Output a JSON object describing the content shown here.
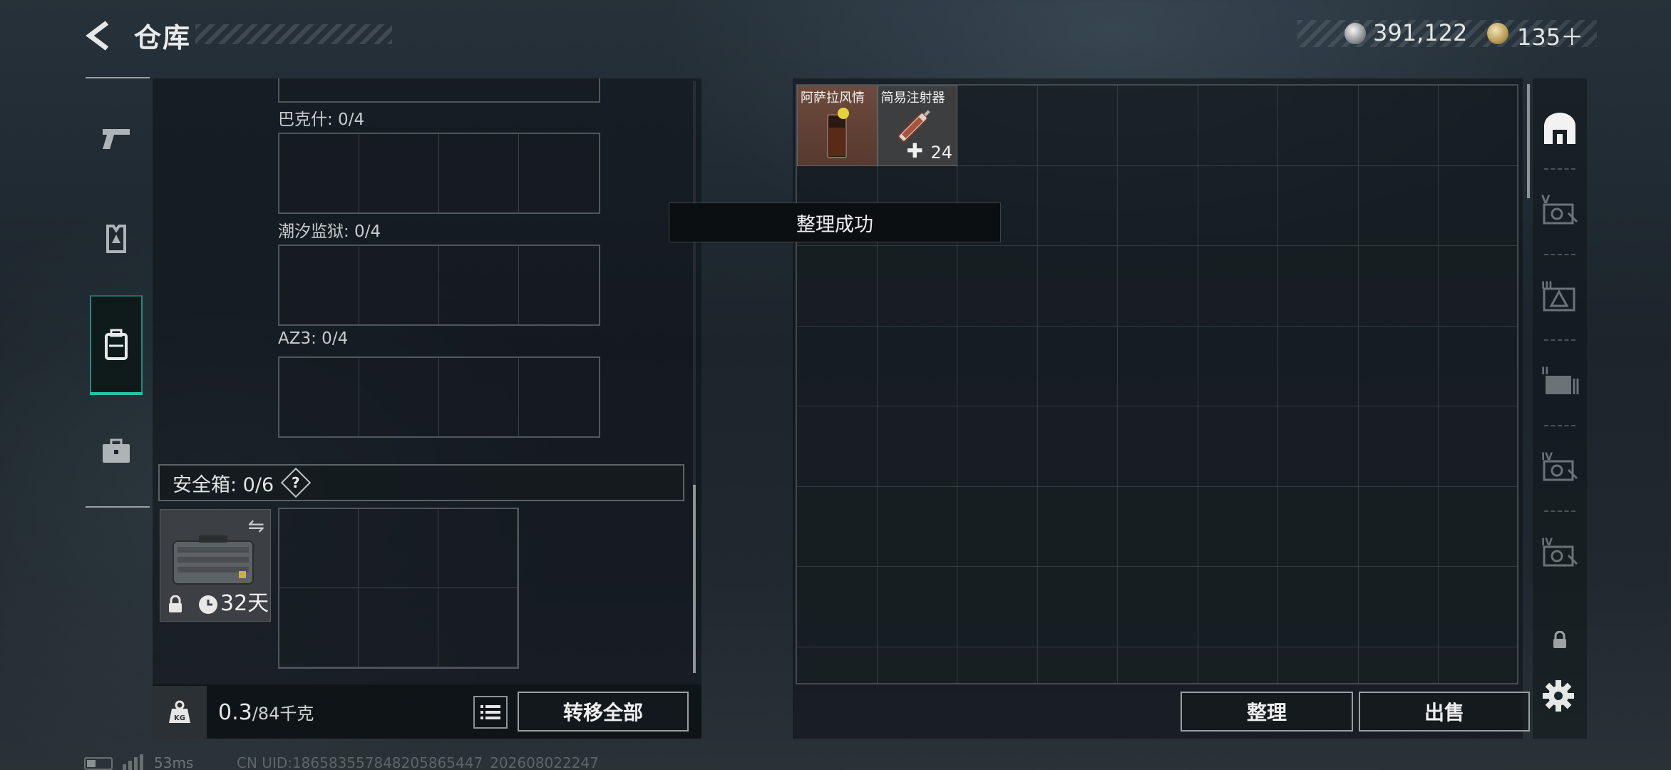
{
  "header": {
    "title": "仓库",
    "currency": [
      {
        "name": "silver-coin",
        "amount": "391,122"
      },
      {
        "name": "gold-coin",
        "amount": "135＋"
      }
    ]
  },
  "left_rail": {
    "items": [
      {
        "name": "weapons",
        "icon": "pistol-icon"
      },
      {
        "name": "armor",
        "icon": "vest-icon"
      },
      {
        "name": "backpack",
        "icon": "backpack-icon",
        "selected": true
      },
      {
        "name": "case",
        "icon": "briefcase-icon"
      }
    ]
  },
  "container": {
    "sections": [
      {
        "label": "巴克什: 0/4"
      },
      {
        "label": "潮汐监狱: 0/4"
      },
      {
        "label": "AZ3: 0/4"
      }
    ],
    "safe_box": {
      "label": "安全箱: 0/6",
      "help": "?",
      "days": "32天"
    },
    "weight_value": "0.3",
    "weight_max": "/84千克",
    "transfer_all_label": "转移全部"
  },
  "stash": {
    "items": [
      {
        "name": "阿萨拉风情",
        "count": ""
      },
      {
        "name": "简易注射器",
        "count": "24"
      }
    ],
    "toast": "整理成功",
    "sort_label": "整理",
    "sell_label": "出售"
  },
  "tier_rail": {
    "items": [
      {
        "name": "storage",
        "icon": "home-vault-icon"
      },
      {
        "name": "tier-V",
        "icon": "tier-v-icon"
      },
      {
        "name": "tier-III",
        "icon": "tier-iii-icon"
      },
      {
        "name": "tier-II",
        "icon": "tier-ii-icon"
      },
      {
        "name": "tier-IV-a",
        "icon": "tier-iv-icon"
      },
      {
        "name": "tier-IV-b",
        "icon": "tier-iv-icon"
      },
      {
        "name": "locked",
        "icon": "lock-icon"
      }
    ]
  },
  "status_bar": {
    "ping": "53ms",
    "uid": "CN UID:18658355784820586544​7_202608022247"
  },
  "colors": {
    "accent": "#27c3a6",
    "panel": "#0c1115",
    "border": "#9aa0a2"
  }
}
